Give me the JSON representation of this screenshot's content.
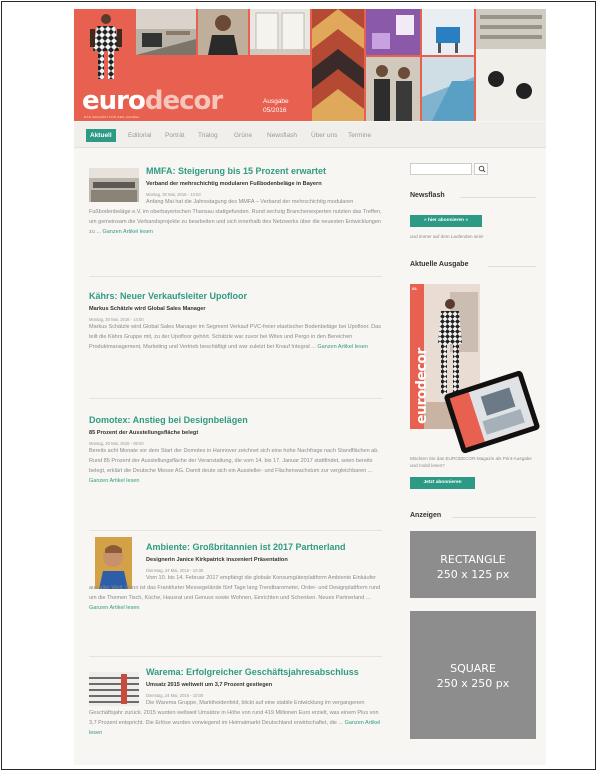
{
  "header": {
    "logo_part1": "euro",
    "logo_part2": "decor",
    "logo_tagline": "DAS MAGAZIN FÜR DEN HANDEL",
    "issue_label": "Ausgabe",
    "issue_number": "05/2016"
  },
  "nav": {
    "items": [
      "Aktuell",
      "Editorial",
      "Porträt",
      "Trialog",
      "Grüne",
      "Newsflash",
      "Über uns",
      "Termine"
    ]
  },
  "articles": [
    {
      "title": "MMFA: Steigerung bis 15 Prozent erwartet",
      "subtitle": "Verband der mehrschichtig modularen Fußbodenbeläge in Bayern",
      "date": "Montag, 30 Mai, 2016 - 14:03",
      "body": "Anfang Mai hat die Jahrestagung des MMFA – Verband der mehrschichtig modularen Fußbodenbeläge e.V. im oberbayerischen Thansau stattgefunden. Rund sechzig Branchenexperten nutzten das Treffen, um gemeinsam die Verbandsprojekte zu bearbeiten und sich innerhalb des Netzwerks über die neuesten Entwicklungen zu ...",
      "more": "Ganzen Artikel lesen"
    },
    {
      "title": "Kährs: Neuer Verkaufsleiter Upofloor",
      "subtitle": "Markus Schätzle wird Global Sales Manager",
      "date": "Montag, 30 Mai, 2016 - 14:00",
      "body": "Markus Schätzle wird Global Sales Manager im Segment Verkauf PVC-freier elastischer Bodenbeläge bei Upofloor. Das teilt die Kährs Gruppe mit, zu der Upofloor gehört. Schätzle war zuvor bei Witex und Pergo in den Bereichen Produktmanagement, Marketing und Vertrieb beschäftigt und war zuletzt bei Knauf Integral ...",
      "more": "Ganzen Artikel lesen"
    },
    {
      "title": "Domotex: Anstieg bei Designbelägen",
      "subtitle": "85 Prozent der Ausstellungsfläche belegt",
      "date": "Montag, 30 Mai, 2016 - 09:00",
      "body": "Bereits acht Monate vor dem Start der Domotex in Hannover zeichnet sich eine hohe Nachfrage nach Standflächen ab. Rund 85 Prozent der Ausstellungsfläche der Veranstaltung, die vom 14. bis 17. Januar 2017 stattfindet, seien bereits belegt, erklärt die Deutsche Messe AG. Damit deute sich ein Aussteller- und Flächenwachstum zur vergleichbaren ...",
      "more": "Ganzen Artikel lesen"
    },
    {
      "title": "Ambiente: Großbritannien ist 2017 Partnerland",
      "subtitle": "Designerin Janice Kirkpatrick inszeniert Präsentation",
      "date": "Dienstag, 24 Mai, 2016 - 10:30",
      "body": "Vom 10. bis 14. Februar 2017 empfängt die globale Konsumgüterplattform Ambiente Einkäufer aus aller Welt. Dann ist das Frankfurter Messegelände fünf Tage lang Trendbarometer, Order- und Designplattform rund um die Themen Tisch, Küche, Hausrat und Genuss sowie Wohnen, Einrichten und Schenken. Neues Partnerland ...",
      "more": "Ganzen Artikel lesen"
    },
    {
      "title": "Warema: Erfolgreicher Geschäftsjahresabschluss",
      "subtitle": "Umsatz 2015 weltweit um 3,7 Prozent gestiegen",
      "date": "Dienstag, 24 Mai, 2016 - 10:00",
      "body": "Die Warema Gruppe, Marktheidenfeld, blickt auf eine stabile Entwicklung im vergangenen Geschäftsjahr zurück. 2015 wurden weltweit Umsätze in Höhe von rund 419 Millionen Euro erzielt, was einem Plus von 3,7 Prozent entspricht. Die Erlöse wurden vorwiegend im Heimatmarkt Deutschland erwirtschaftet, die ...",
      "more": "Ganzen Artikel lesen"
    }
  ],
  "sidebar": {
    "search_placeholder": "",
    "newsflash_title": "Newsflash",
    "subscribe_button": "» hier abonnieren «",
    "newsflash_text": "und immer auf dem Laufenden sein!",
    "current_issue_title": "Aktuelle Ausgabe",
    "cover_logo": "eurodecor",
    "cover_issue": "05.",
    "issue_text": "Möchten Sie das EURODECOR-Magazin als Print-Ausgabe und mobil lesen?",
    "issue_button": "Jetzt abonnieren",
    "ads_title": "Anzeigen",
    "ad_rectangle_line1": "RECTANGLE",
    "ad_rectangle_line2": "250 x 125 px",
    "ad_square_line1": "SQUARE",
    "ad_square_line2": "250 x 250 px"
  },
  "colors": {
    "brand_coral": "#e8604f",
    "accent_green": "#2c9a84",
    "ad_gray": "#8d8d8d"
  }
}
